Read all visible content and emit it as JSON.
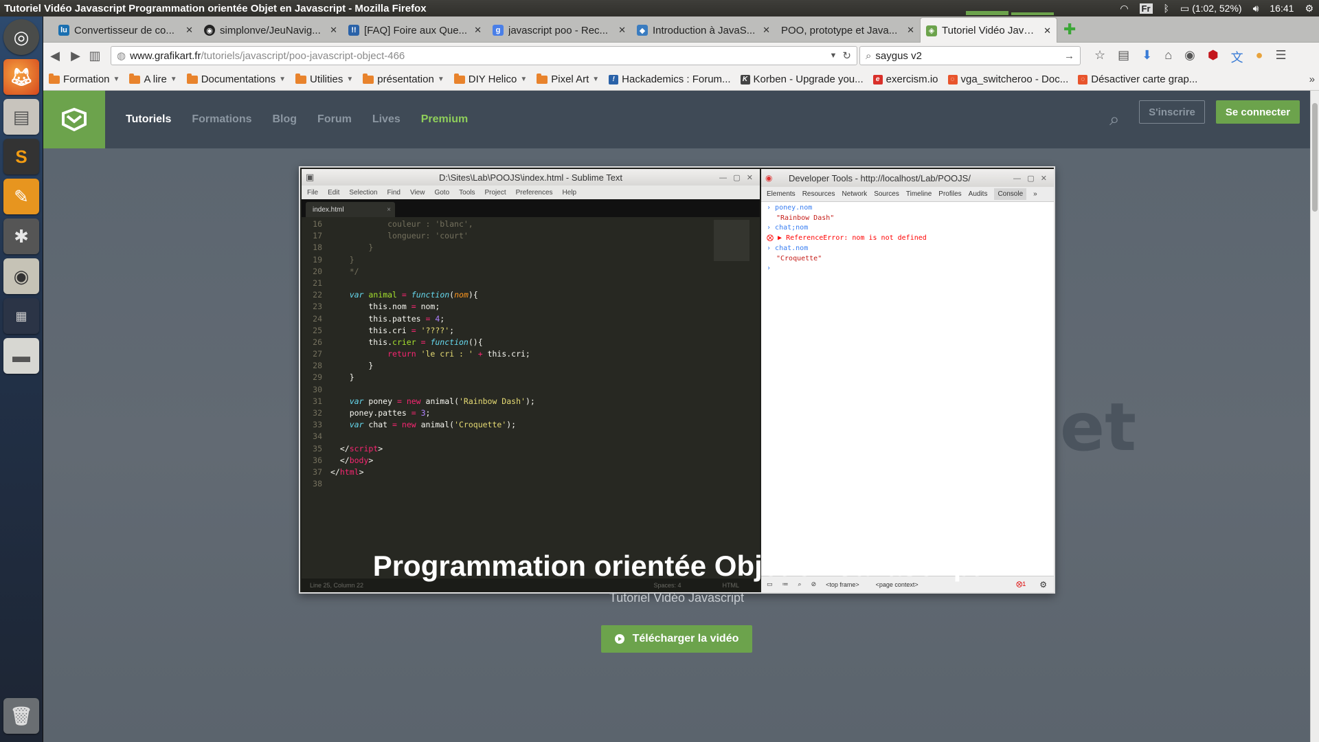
{
  "window_title": "Tutoriel Vidéo Javascript Programmation orientée Objet en Javascript - Mozilla Firefox",
  "tray": {
    "lang": "Fr",
    "battery": "(1:02, 52%)",
    "clock": "16:41"
  },
  "tabs": [
    {
      "label": "Convertisseur de co...",
      "favicon_color": "#1a6fb0",
      "favicon_text": "lu"
    },
    {
      "label": "simplonve/JeuNavig...",
      "favicon_color": "#222222",
      "favicon_text": "◉"
    },
    {
      "label": "[FAQ] Foire aux Que...",
      "favicon_color": "#2a62a8",
      "favicon_text": "!!"
    },
    {
      "label": "javascript poo - Rec...",
      "favicon_color": "#4a7fe8",
      "favicon_text": "g"
    },
    {
      "label": "Introduction à JavaS...",
      "favicon_color": "#3a7cc0",
      "favicon_text": "◆"
    },
    {
      "label": "POO, prototype et Java...",
      "favicon_color": "",
      "favicon_text": ""
    },
    {
      "label": "Tutoriel Vidéo Javas...",
      "favicon_color": "#6ca34c",
      "favicon_text": "◈"
    }
  ],
  "url": {
    "domain": "www.grafikart.fr",
    "path": "/tutoriels/javascript/poo-javascript-object-466"
  },
  "search": {
    "value": "saygus v2"
  },
  "bookmarks": [
    {
      "label": "Formation",
      "type": "folder"
    },
    {
      "label": "A lire",
      "type": "folder"
    },
    {
      "label": "Documentations",
      "type": "folder"
    },
    {
      "label": "Utilities",
      "type": "folder"
    },
    {
      "label": "présentation",
      "type": "folder"
    },
    {
      "label": "DIY Helico",
      "type": "folder"
    },
    {
      "label": "Pixel Art",
      "type": "folder"
    },
    {
      "label": "Hackademics : Forum...",
      "type": "link",
      "color": "#2a62a8"
    },
    {
      "label": "Korben - Upgrade you...",
      "type": "link",
      "color": "#444444"
    },
    {
      "label": "exercism.io",
      "type": "link",
      "color": "#d9302a"
    },
    {
      "label": "vga_switcheroo - Doc...",
      "type": "link",
      "color": "#e8542c"
    },
    {
      "label": "Désactiver carte grap...",
      "type": "link",
      "color": "#e8542c"
    }
  ],
  "site": {
    "nav": [
      "Tutoriels",
      "Formations",
      "Blog",
      "Forum",
      "Lives",
      "Premium"
    ],
    "signup": "S'inscrire",
    "login": "Se connecter",
    "hero_title": "Programmation orientée Objet en Javascript",
    "hero_subtitle": "Tutoriel Vidéo Javascript",
    "download": "Télécharger la vidéo",
    "blurred_word": "et"
  },
  "video": {
    "sublime_title": "D:\\Sites\\Lab\\POOJS\\index.html - Sublime Text",
    "sublime_menu": [
      "File",
      "Edit",
      "Selection",
      "Find",
      "View",
      "Goto",
      "Tools",
      "Project",
      "Preferences",
      "Help"
    ],
    "sublime_tab": "index.html",
    "sublime_status_left": "Line 25, Column 22",
    "sublime_status_spaces": "Spaces: 4",
    "sublime_status_syntax": "HTML",
    "devtools_title": "Developer Tools - http://localhost/Lab/POOJS/",
    "devtools_tabs": [
      "Elements",
      "Resources",
      "Network",
      "Sources",
      "Timeline",
      "Profiles",
      "Audits",
      "Console",
      "»"
    ],
    "console": [
      {
        "kind": "in",
        "text": "poney.nom"
      },
      {
        "kind": "out",
        "text": "\"Rainbow Dash\""
      },
      {
        "kind": "in",
        "text": "chat;nom"
      },
      {
        "kind": "err",
        "text": "▶ ReferenceError: nom is not defined"
      },
      {
        "kind": "in",
        "text": "chat.nom"
      },
      {
        "kind": "out",
        "text": "\"Croquette\""
      },
      {
        "kind": "in",
        "text": ""
      }
    ],
    "devtools_footer": [
      "<top frame>",
      "<page context>"
    ],
    "error_count": "1"
  }
}
